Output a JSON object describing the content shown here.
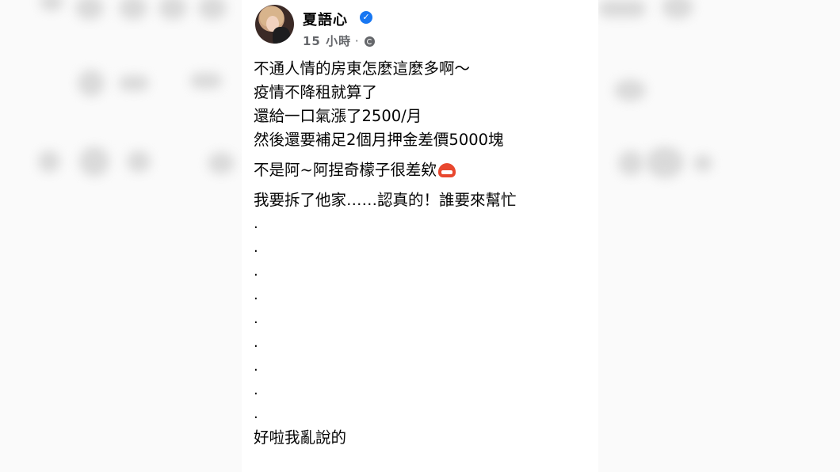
{
  "post": {
    "author": "夏語心",
    "time": "15 小時",
    "separator": "·",
    "privacy_icon": "globe-icon",
    "verified_icon": "verified-badge-icon",
    "lines": [
      "不通人情的房東怎麼這麼多啊～",
      "疫情不降租就算了",
      "還給一口氣漲了2500/月",
      "然後還要補足2個月押金差價5000塊",
      "不是阿~阿捏奇檬子很差欸",
      "我要拆了他家……認真的！誰要來幫忙",
      ".",
      ".",
      ".",
      ".",
      ".",
      ".",
      ".",
      ".",
      ".",
      "好啦我亂說的"
    ],
    "emoji": "rage-face-emoji"
  },
  "colors": {
    "text": "#050505",
    "secondary": "#65676b",
    "verified": "#1877f2"
  }
}
